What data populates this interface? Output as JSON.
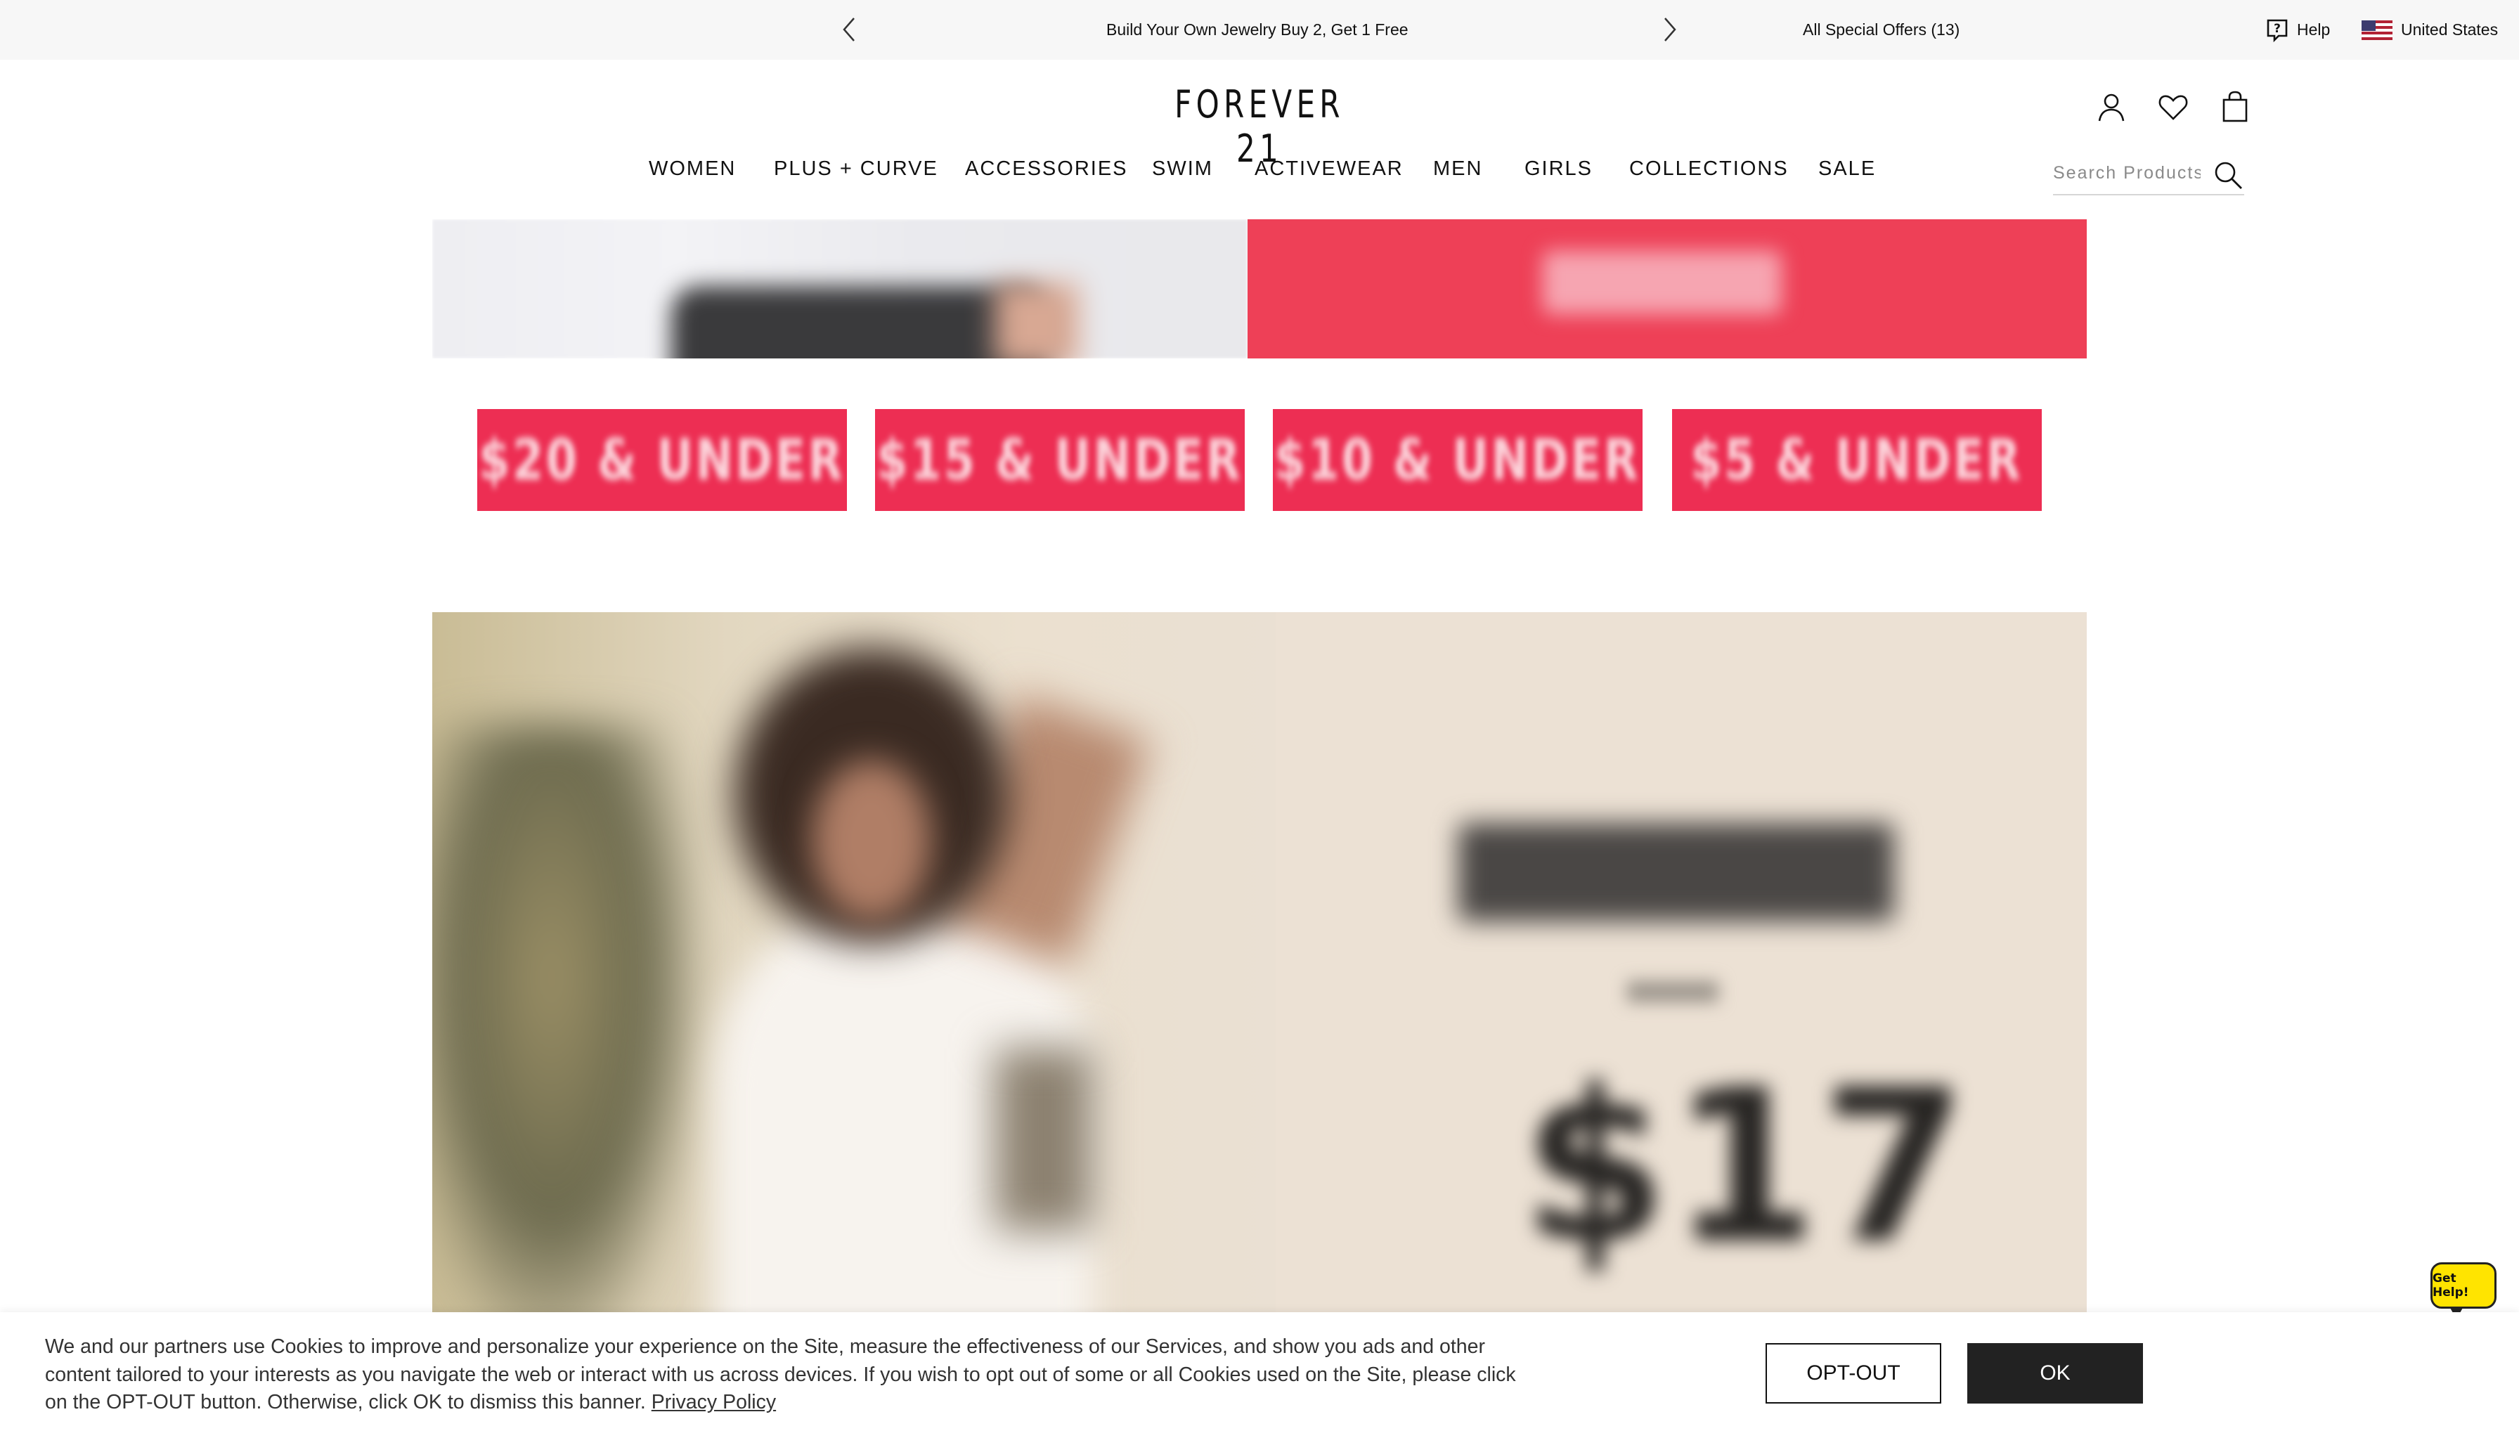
{
  "promo": {
    "message": "Build Your Own Jewelry Buy 2, Get 1 Free",
    "offers": "All Special Offers (13)",
    "help": "Help",
    "country": "United States",
    "prev_icon": "chevron-left-icon",
    "next_icon": "chevron-right-icon"
  },
  "header": {
    "logo": "FOREVER 21",
    "icons": [
      "account-icon",
      "heart-icon",
      "bag-icon"
    ]
  },
  "nav": {
    "items": [
      "WOMEN",
      "PLUS + CURVE",
      "ACCESSORIES",
      "SWIM",
      "ACTIVEWEAR",
      "MEN",
      "GIRLS",
      "COLLECTIONS",
      "SALE"
    ]
  },
  "search": {
    "placeholder": "Search Products",
    "icon": "search-icon"
  },
  "price_tiles": [
    "$20 & UNDER",
    "$15 & UNDER",
    "$10 & UNDER",
    "$5 & UNDER"
  ],
  "hero": {
    "price_text": "$17"
  },
  "chat": {
    "label": "Get Help!"
  },
  "cookie": {
    "text": "We and our partners use Cookies to improve and personalize your experience on the Site, measure the effectiveness of our Services, and show you ads and other content tailored to your interests as you navigate the web or interact with us across devices. If you wish to opt out of some or all Cookies used on the Site, please click on the OPT-OUT button. Otherwise, click OK to dismiss this banner.",
    "link": "Privacy Policy",
    "optout": "OPT-OUT",
    "ok": "OK"
  },
  "colors": {
    "accent_red": "#ed2e53",
    "promo_bg": "#f7f7f7",
    "chat_yellow": "#ffe400"
  }
}
